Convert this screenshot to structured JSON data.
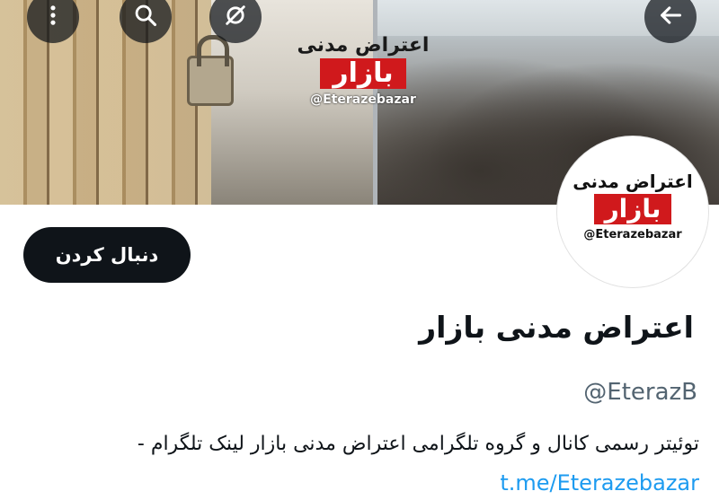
{
  "banner": {
    "watermark_title": "اعتراض مدنی",
    "watermark_box": "بازار",
    "watermark_handle": "@Eterazebazar"
  },
  "nav": {
    "more_icon": "more-vertical-icon",
    "search_icon": "search-icon",
    "mute_icon": "mute-icon",
    "back_icon": "arrow-left-icon"
  },
  "avatar": {
    "title": "اعتراض مدنی",
    "box": "بازار",
    "handle": "@Eterazebazar"
  },
  "profile": {
    "follow_label": "دنبال کردن",
    "display_name": "اعتراض مدنی بازار",
    "handle": "@EterazB",
    "bio": "توئیتر رسمی کانال و گروه تلگرامی اعتراض مدنی بازار لینک تلگرام -",
    "link": "t.me/Eterazebazar"
  },
  "colors": {
    "accent": "#1d9bf0",
    "button_bg": "#0f1419",
    "brand_red": "#d0191c"
  }
}
